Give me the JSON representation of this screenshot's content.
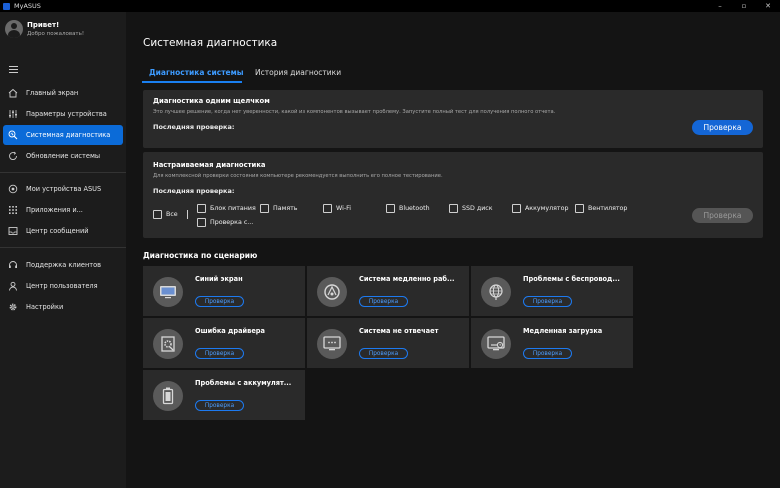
{
  "window": {
    "title": "MyASUS"
  },
  "user": {
    "greeting": "Привет!",
    "welcome": "Добро пожаловать!"
  },
  "sidebar": {
    "items": [
      {
        "label": "Главный экран",
        "icon": "home-icon"
      },
      {
        "label": "Параметры устройства",
        "icon": "sliders-icon"
      },
      {
        "label": "Системная диагностика",
        "icon": "diagnostic-icon",
        "active": true
      },
      {
        "label": "Обновление системы",
        "icon": "update-icon"
      },
      {
        "label": "Мои устройства ASUS",
        "icon": "devices-icon"
      },
      {
        "label": "Приложения и...",
        "icon": "apps-icon"
      },
      {
        "label": "Центр сообщений",
        "icon": "message-icon"
      },
      {
        "label": "Поддержка клиентов",
        "icon": "headset-icon"
      },
      {
        "label": "Центр пользователя",
        "icon": "user-icon"
      },
      {
        "label": "Настройки",
        "icon": "gear-icon"
      }
    ]
  },
  "main": {
    "title": "Системная диагностика",
    "tabs": [
      {
        "label": "Диагностика системы",
        "active": true
      },
      {
        "label": "История диагностики"
      }
    ],
    "one_click": {
      "title": "Диагностика одним щелчком",
      "desc": "Это лучшее решение, когда нет уверенности, какой из компонентов вызывает проблему. Запустите полный тест для получения полного отчета.",
      "last_check": "Последняя проверка:",
      "button": "Проверка"
    },
    "custom": {
      "title": "Настраиваемая диагностика",
      "desc": "Для комплексной проверки состояния компьютере рекомендуется выполнить его полное тестирование.",
      "last_check": "Последняя проверка:",
      "all_label": "Все",
      "options": [
        "Блок питания",
        "Память",
        "Wi-Fi",
        "Bluetooth",
        "SSD диск",
        "Аккумулятор",
        "Вентилятор",
        "Проверка с..."
      ],
      "button": "Проверка"
    },
    "scenario": {
      "title": "Диагностика по сценарию",
      "button_label": "Проверка",
      "items": [
        {
          "title": "Синий экран",
          "icon": "blue-screen-icon"
        },
        {
          "title": "Система медленно раб...",
          "icon": "slow-system-icon"
        },
        {
          "title": "Проблемы с беспровод...",
          "icon": "wireless-icon"
        },
        {
          "title": "Ошибка драйвера",
          "icon": "driver-error-icon"
        },
        {
          "title": "Система не отвечает",
          "icon": "not-responding-icon"
        },
        {
          "title": "Медленная загрузка",
          "icon": "slow-boot-icon"
        },
        {
          "title": "Проблемы с аккумулят...",
          "icon": "battery-icon"
        }
      ]
    }
  },
  "colors": {
    "accent": "#1466d6",
    "active_nav": "#0b6bd8",
    "tab_active": "#3d9bff"
  }
}
